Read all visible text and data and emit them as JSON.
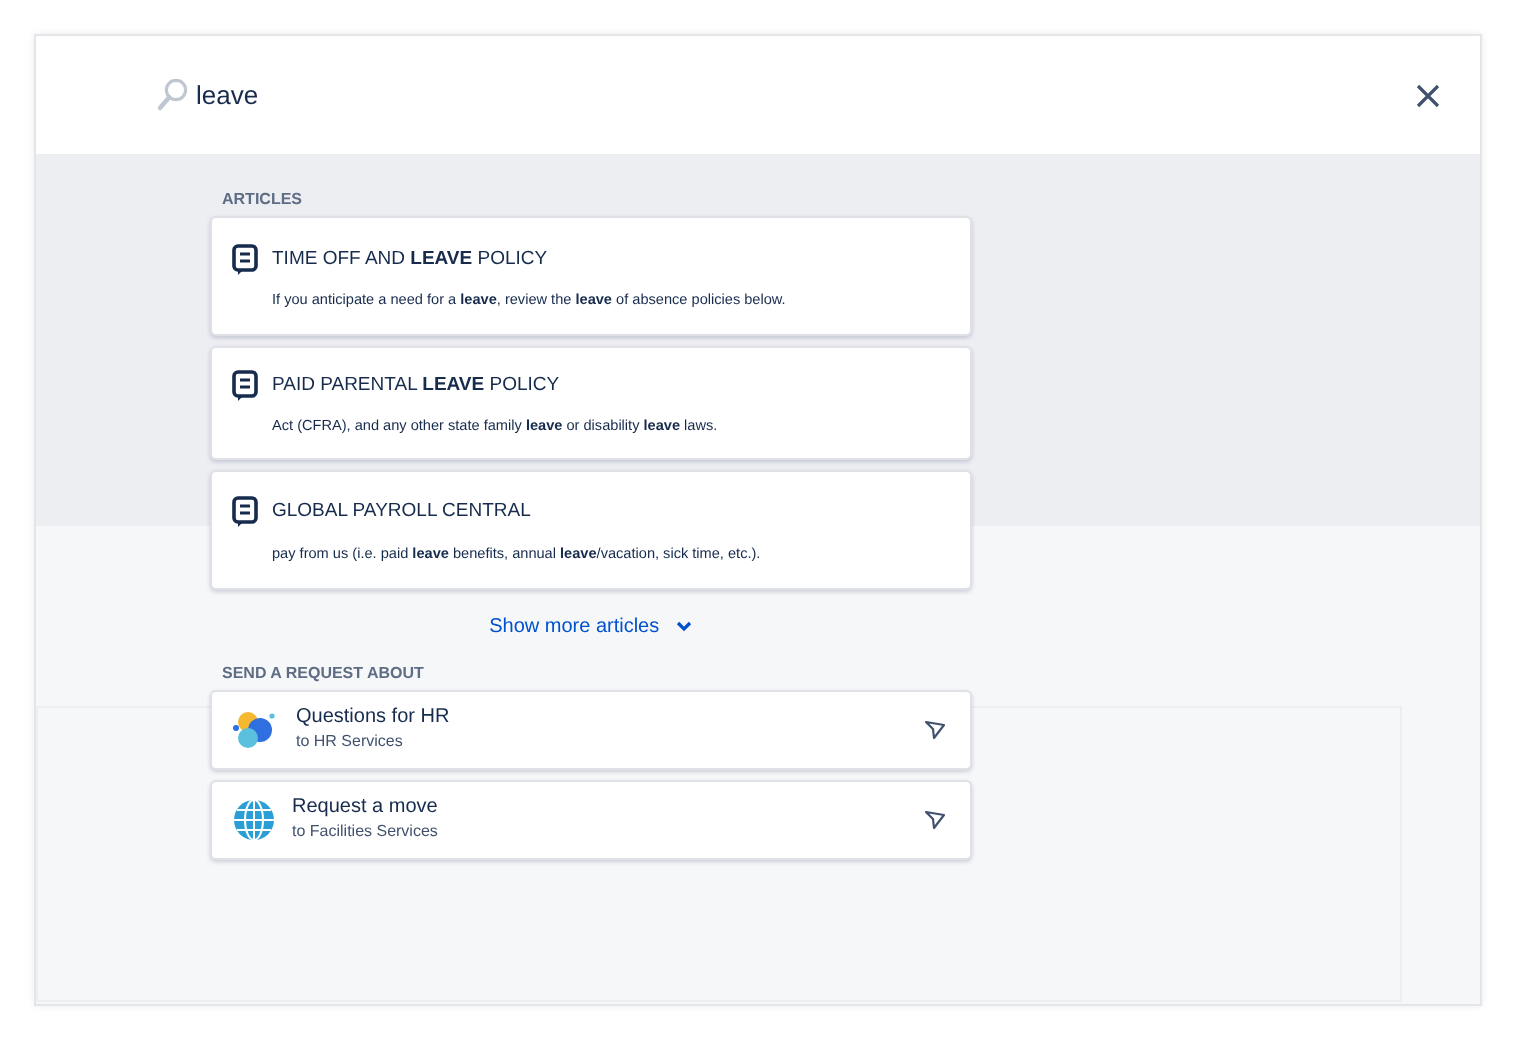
{
  "search": {
    "value": "leave"
  },
  "articles": {
    "heading": "ARTICLES",
    "items": [
      {
        "title": "TIME OFF AND **LEAVE** POLICY",
        "snippet": "If you anticipate a need for a **leave**, review the **leave** of absence policies below."
      },
      {
        "title": "PAID PARENTAL **LEAVE** POLICY",
        "snippet": "Act (CFRA), and any other state family **leave** or disability **leave** laws."
      },
      {
        "title": "GLOBAL PAYROLL CENTRAL",
        "snippet": "pay from us (i.e. paid **leave** benefits, annual **leave**/vacation, sick time, etc.)."
      }
    ],
    "show_more": "Show more articles"
  },
  "requests": {
    "heading": "SEND A REQUEST ABOUT",
    "items": [
      {
        "title": "Questions for HR",
        "subtitle": "to HR Services",
        "kind": "chat"
      },
      {
        "title": "Request a move",
        "subtitle": "to Facilities Services",
        "kind": "globe"
      }
    ]
  }
}
